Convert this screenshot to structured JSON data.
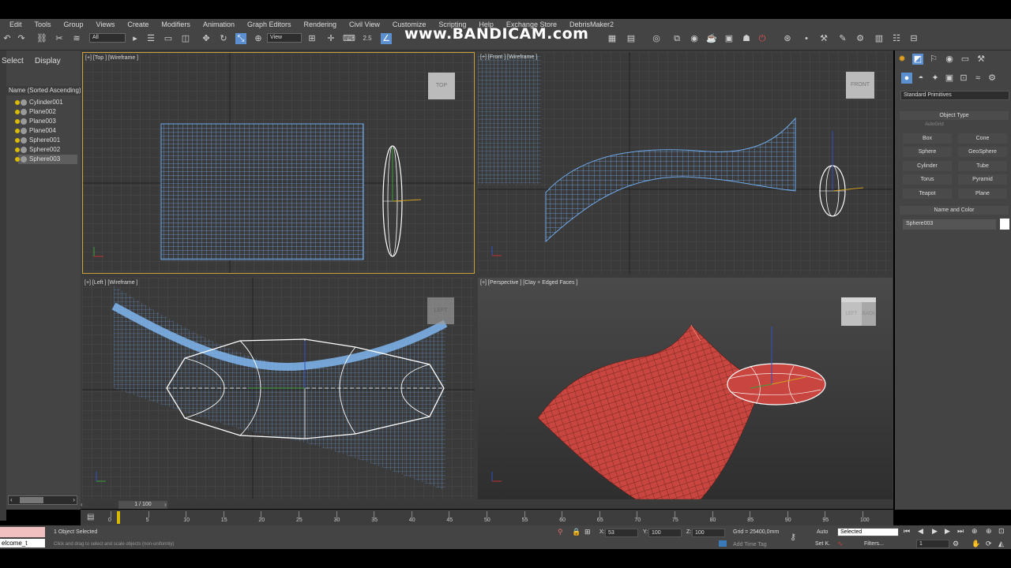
{
  "watermark": "www.BANDICAM.com",
  "menu": [
    "Edit",
    "Tools",
    "Group",
    "Views",
    "Create",
    "Modifiers",
    "Animation",
    "Graph Editors",
    "Rendering",
    "Civil View",
    "Customize",
    "Scripting",
    "Help",
    "Exchange Store",
    "DebrisMaker2"
  ],
  "toolbar": {
    "selection_filter": "All",
    "reference_coord": "View",
    "angle_snap": "2.5"
  },
  "scene_explorer": {
    "tabs": [
      "Select",
      "Display"
    ],
    "column_header": "Name (Sorted Ascending)",
    "objects": [
      "Cylinder001",
      "Plane002",
      "Plane003",
      "Plane004",
      "Sphere001",
      "Sphere002",
      "Sphere003"
    ],
    "selected": "Sphere003"
  },
  "viewports": {
    "top": {
      "label": "[+] [Top ] [Wireframe ]",
      "cube": "TOP"
    },
    "front": {
      "label": "[+] [Front ] [Wireframe ]",
      "cube": "FRONT"
    },
    "left": {
      "label": "[+] [Left ] [Wireframe ]",
      "cube": "LEFT"
    },
    "perspective": {
      "label": "[+] [Perspective ] [Clay + Edged Faces ]",
      "cube_front": "LEFT",
      "cube_side": "BACK"
    }
  },
  "command_panel": {
    "category": "Standard Primitives",
    "object_type_title": "Object Type",
    "autogrid": "AutoGrid",
    "buttons": [
      "Box",
      "Cone",
      "Sphere",
      "GeoSphere",
      "Cylinder",
      "Tube",
      "Torus",
      "Pyramid",
      "Teapot",
      "Plane"
    ],
    "name_color_title": "Name and Color",
    "object_name": "Sphere003",
    "swatch_color": "#ffffff"
  },
  "timeline": {
    "frame_label": "1 / 100",
    "ticks": [
      "0",
      "5",
      "10",
      "15",
      "20",
      "25",
      "30",
      "35",
      "40",
      "45",
      "50",
      "55",
      "60",
      "65",
      "70",
      "75",
      "80",
      "85",
      "90",
      "95",
      "100"
    ]
  },
  "status": {
    "maxscript": "elcome_t",
    "selection_text": "1 Object Selected",
    "prompt_text": "Click and drag to select and scale objects (non-uniformly)",
    "x_label": "X:",
    "x_value": "53",
    "y_label": "Y:",
    "y_value": "100",
    "z_label": "Z:",
    "z_value": "100",
    "grid": "Grid = 25400,0mm",
    "add_time_tag": "Add Time Tag",
    "auto": "Auto",
    "selected_dropdown": "Selected",
    "set_k": "Set K.",
    "filters": "Filters...",
    "current_frame": "1"
  },
  "colors": {
    "wire_blue": "#6fa8e8",
    "clay_red": "#c8463f",
    "selected_yellow": "#d8b800"
  }
}
